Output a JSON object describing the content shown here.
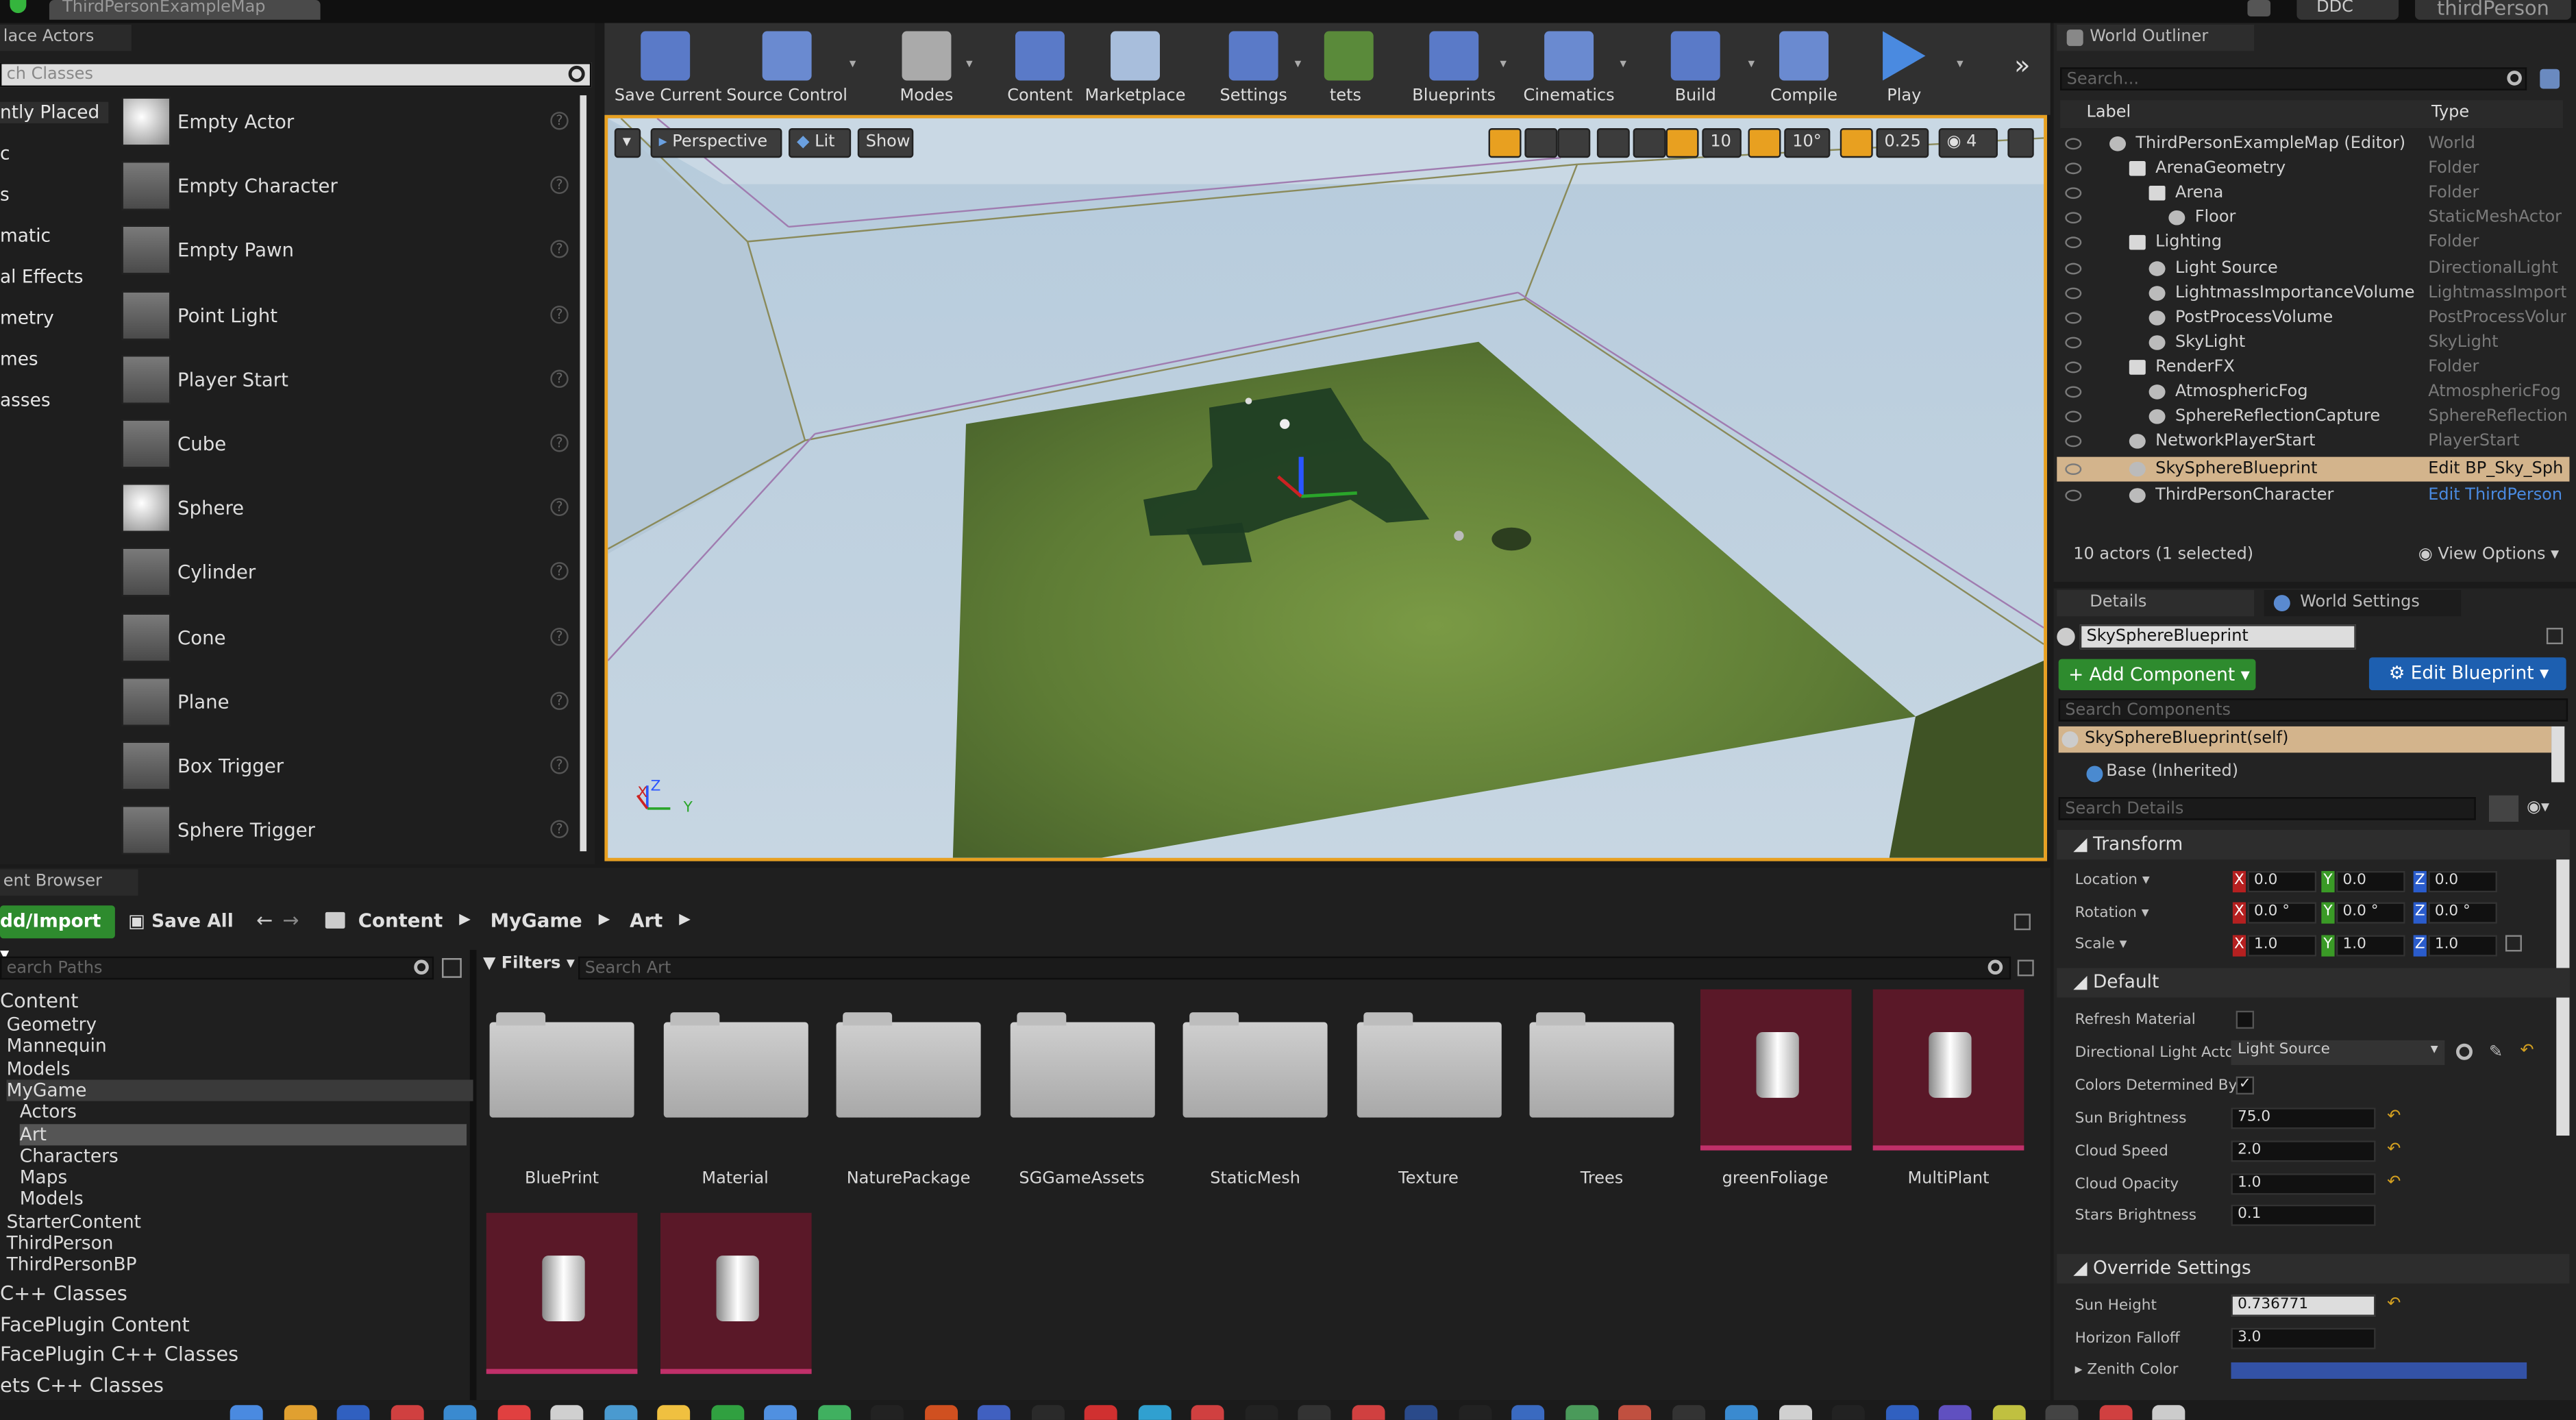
{
  "window": {
    "map_tab": "ThirdPersonExampleMap",
    "ddc": "DDC",
    "project": "thirdPerson"
  },
  "place_actors": {
    "tab": "lace Actors",
    "search_placeholder": "ch Classes",
    "categories": [
      "ntly Placed",
      "c",
      "s",
      "matic",
      "al Effects",
      "metry",
      "mes",
      "asses"
    ],
    "items": [
      {
        "label": "Empty Actor",
        "icon": "sphere-icon"
      },
      {
        "label": "Empty Character",
        "icon": "character-icon"
      },
      {
        "label": "Empty Pawn",
        "icon": "pawn-icon"
      },
      {
        "label": "Point Light",
        "icon": "bulb-icon"
      },
      {
        "label": "Player Start",
        "icon": "player-start-icon"
      },
      {
        "label": "Cube",
        "icon": "cube-icon"
      },
      {
        "label": "Sphere",
        "icon": "sphere-icon"
      },
      {
        "label": "Cylinder",
        "icon": "cylinder-icon"
      },
      {
        "label": "Cone",
        "icon": "cone-icon"
      },
      {
        "label": "Plane",
        "icon": "plane-icon"
      },
      {
        "label": "Box Trigger",
        "icon": "box-trigger-icon"
      },
      {
        "label": "Sphere Trigger",
        "icon": "sphere-trigger-icon"
      }
    ],
    "help_glyph": "?"
  },
  "toolbar": {
    "buttons": [
      {
        "label": "Save Current",
        "icon": "save-icon"
      },
      {
        "label": "Source Control",
        "icon": "source-control-icon"
      },
      {
        "label": "Modes",
        "icon": "modes-icon"
      },
      {
        "label": "Content",
        "icon": "content-icon"
      },
      {
        "label": "Marketplace",
        "icon": "marketplace-icon"
      },
      {
        "label": "Settings",
        "icon": "settings-icon"
      },
      {
        "label": "tets",
        "icon": "tets-icon"
      },
      {
        "label": "Blueprints",
        "icon": "blueprints-icon"
      },
      {
        "label": "Cinematics",
        "icon": "cinematics-icon"
      },
      {
        "label": "Build",
        "icon": "build-icon"
      },
      {
        "label": "Compile",
        "icon": "compile-icon"
      },
      {
        "label": "Play",
        "icon": "play-icon"
      }
    ]
  },
  "viewport": {
    "perspective": "Perspective",
    "lit": "Lit",
    "show": "Show",
    "grid_snap": "10",
    "rot_snap": "10°",
    "scale_snap": "0.25",
    "cam_speed": "4",
    "axis_x": "X",
    "axis_y": "Y",
    "axis_z": "Z"
  },
  "outliner": {
    "tab": "World Outliner",
    "search_placeholder": "Search...",
    "col_label": "Label",
    "col_type": "Type",
    "rows": [
      {
        "label": "ThirdPersonExampleMap (Editor)",
        "type": "World",
        "indent": 0
      },
      {
        "label": "ArenaGeometry",
        "type": "Folder",
        "indent": 1
      },
      {
        "label": "Arena",
        "type": "Folder",
        "indent": 2
      },
      {
        "label": "Floor",
        "type": "StaticMeshActor",
        "indent": 3
      },
      {
        "label": "Lighting",
        "type": "Folder",
        "indent": 1
      },
      {
        "label": "Light Source",
        "type": "DirectionalLight",
        "indent": 2
      },
      {
        "label": "LightmassImportanceVolume",
        "type": "LightmassImporta",
        "indent": 2
      },
      {
        "label": "PostProcessVolume",
        "type": "PostProcessVolum",
        "indent": 2
      },
      {
        "label": "SkyLight",
        "type": "SkyLight",
        "indent": 2
      },
      {
        "label": "RenderFX",
        "type": "Folder",
        "indent": 1
      },
      {
        "label": "AtmosphericFog",
        "type": "AtmosphericFog",
        "indent": 2
      },
      {
        "label": "SphereReflectionCapture",
        "type": "SphereReflectionC",
        "indent": 2
      },
      {
        "label": "NetworkPlayerStart",
        "type": "PlayerStart",
        "indent": 1
      },
      {
        "label": "SkySphereBlueprint",
        "type": "Edit BP_Sky_Sph",
        "indent": 1,
        "selected": true
      },
      {
        "label": "ThirdPersonCharacter",
        "type": "Edit ThirdPerson",
        "indent": 1
      }
    ],
    "status": "10 actors (1 selected)",
    "view_options": "View Options"
  },
  "details": {
    "tab_details": "Details",
    "tab_world": "World Settings",
    "actor_name": "SkySphereBlueprint",
    "add_component": "+ Add Component",
    "edit_blueprint": "Edit Blueprint",
    "search_components": "Search Components",
    "component_self": "SkySphereBlueprint(self)",
    "component_base": "Base (Inherited)",
    "search_details": "Search Details",
    "transform_title": "Transform",
    "location": "Location",
    "rotation": "Rotation",
    "scale": "Scale",
    "loc": [
      "0.0",
      "0.0",
      "0.0"
    ],
    "rot": [
      "0.0 °",
      "0.0 °",
      "0.0 °"
    ],
    "scl": [
      "1.0",
      "1.0",
      "1.0"
    ],
    "default_title": "Default",
    "refresh_material": "Refresh Material",
    "dir_light_actor": "Directional Light Actor",
    "dir_light_value": "Light Source",
    "colors_determined": "Colors Determined By S",
    "sun_brightness": "Sun Brightness",
    "sun_brightness_v": "75.0",
    "cloud_speed": "Cloud Speed",
    "cloud_speed_v": "2.0",
    "cloud_opacity": "Cloud Opacity",
    "cloud_opacity_v": "1.0",
    "stars_brightness": "Stars Brightness",
    "stars_brightness_v": "0.1",
    "override_title": "Override Settings",
    "sun_height": "Sun Height",
    "sun_height_v": "0.736771",
    "horizon_falloff": "Horizon Falloff",
    "horizon_falloff_v": "3.0",
    "zenith_color": "Zenith Color"
  },
  "content_browser": {
    "tab": "ent Browser",
    "add_import": "dd/Import",
    "save_all": "Save All",
    "breadcrumb": [
      "Content",
      "MyGame",
      "Art"
    ],
    "search_paths": "earch Paths",
    "filters": "Filters",
    "search_art": "Search Art",
    "tree": [
      {
        "label": "Content",
        "indent": 0,
        "big": true
      },
      {
        "label": "Geometry",
        "indent": 1
      },
      {
        "label": "Mannequin",
        "indent": 1
      },
      {
        "label": "Models",
        "indent": 1
      },
      {
        "label": "MyGame",
        "indent": 1,
        "hl": true
      },
      {
        "label": "Actors",
        "indent": 2
      },
      {
        "label": "Art",
        "indent": 2,
        "sel": true
      },
      {
        "label": "Characters",
        "indent": 2
      },
      {
        "label": "Maps",
        "indent": 2
      },
      {
        "label": "Models",
        "indent": 2
      },
      {
        "label": "StarterContent",
        "indent": 1
      },
      {
        "label": "ThirdPerson",
        "indent": 1
      },
      {
        "label": "ThirdPersonBP",
        "indent": 1
      },
      {
        "label": "C++ Classes",
        "indent": 0,
        "big": true
      },
      {
        "label": "FacePlugin Content",
        "indent": 0,
        "big": true
      },
      {
        "label": "FacePlugin C++ Classes",
        "indent": 0,
        "big": true
      },
      {
        "label": "ets C++ Classes",
        "indent": 0,
        "big": true
      }
    ],
    "assets": [
      {
        "label": "BluePrint",
        "kind": "folder"
      },
      {
        "label": "Material",
        "kind": "folder"
      },
      {
        "label": "NaturePackage",
        "kind": "folder"
      },
      {
        "label": "SGGameAssets",
        "kind": "folder"
      },
      {
        "label": "StaticMesh",
        "kind": "folder"
      },
      {
        "label": "Texture",
        "kind": "folder"
      },
      {
        "label": "Trees",
        "kind": "folder"
      },
      {
        "label": "greenFoliage",
        "kind": "mesh"
      },
      {
        "label": "MultiPlant",
        "kind": "mesh"
      },
      {
        "label": "",
        "kind": "mesh"
      },
      {
        "label": "",
        "kind": "mesh"
      }
    ]
  },
  "colors": {
    "accent_orange": "#e8a020",
    "selected_row": "#d3b48c",
    "add_green": "#2e8b2e",
    "edit_blue": "#1d5fb0",
    "asset_mesh_bg": "#5a1828"
  }
}
